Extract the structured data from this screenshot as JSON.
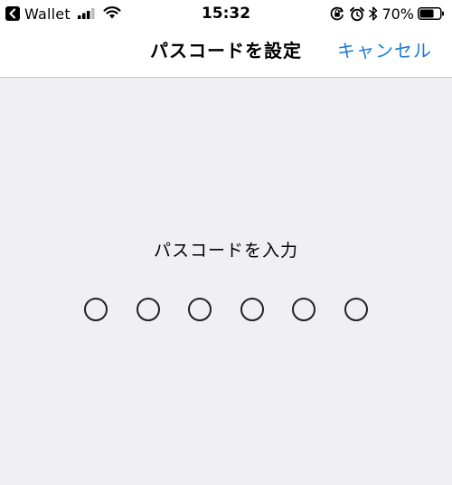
{
  "status_bar": {
    "back_app": "Wallet",
    "time": "15:32",
    "battery_percent": "70%",
    "battery_level": 0.7,
    "icons": [
      "back-arrow-icon",
      "signal-icon",
      "wifi-icon",
      "orientation-lock-icon",
      "alarm-icon",
      "bluetooth-icon",
      "battery-icon"
    ]
  },
  "nav": {
    "title": "パスコードを設定",
    "cancel_label": "キャンセル"
  },
  "passcode": {
    "prompt": "パスコードを入力",
    "digit_count": 6,
    "entered_count": 0
  },
  "colors": {
    "accent": "#1a7ad9",
    "background": "#efeff4",
    "bar_background": "#ffffff"
  }
}
